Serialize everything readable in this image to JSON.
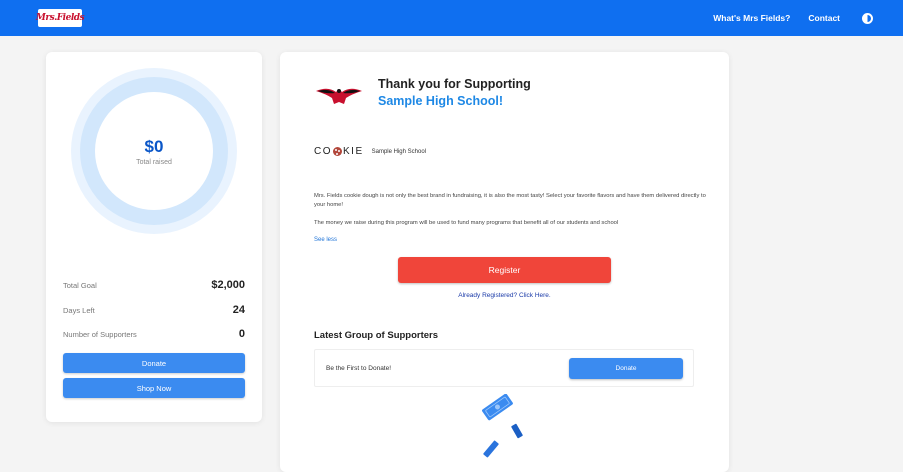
{
  "header": {
    "logo_text": "Mrs.Fields",
    "nav": [
      "What's Mrs Fields?",
      "Contact"
    ],
    "contrast_icon": "contrast-icon"
  },
  "sidebar": {
    "raised_amount": "$0",
    "raised_label": "Total raised",
    "raised_progress": 0,
    "stats": [
      {
        "label": "Total Goal",
        "value": "$2,000"
      },
      {
        "label": "Days Left",
        "value": "24"
      },
      {
        "label": "Number of Supporters",
        "value": "0"
      }
    ],
    "donate_label": "Donate",
    "shop_label": "Shop Now"
  },
  "main": {
    "thanks_title": "Thank you for Supporting",
    "school_name": "Sample High School!",
    "cookie_brand_start": "CO",
    "cookie_brand_end": "KIE",
    "cookie_school": "Sample High School",
    "description_1": "Mrs. Fields cookie dough is not only the best brand in fundraising, it is also the most tasty! Select your favorite flavors and have them delivered directly to your home!",
    "description_2": "The money we raise during this program will be used to fund many programs that benefit all of our students and school",
    "see_less": "See less",
    "register_label": "Register",
    "already_registered": "Already Registered? Click Here.",
    "supporters_title": "Latest Group of Supporters",
    "first_to_donate": "Be the First to Donate!",
    "donate_label": "Donate"
  },
  "colors": {
    "brand_blue": "#0f6ff0",
    "button_blue": "#3b8bf0",
    "register_red": "#f0453a",
    "school_blue": "#1e88e5"
  }
}
